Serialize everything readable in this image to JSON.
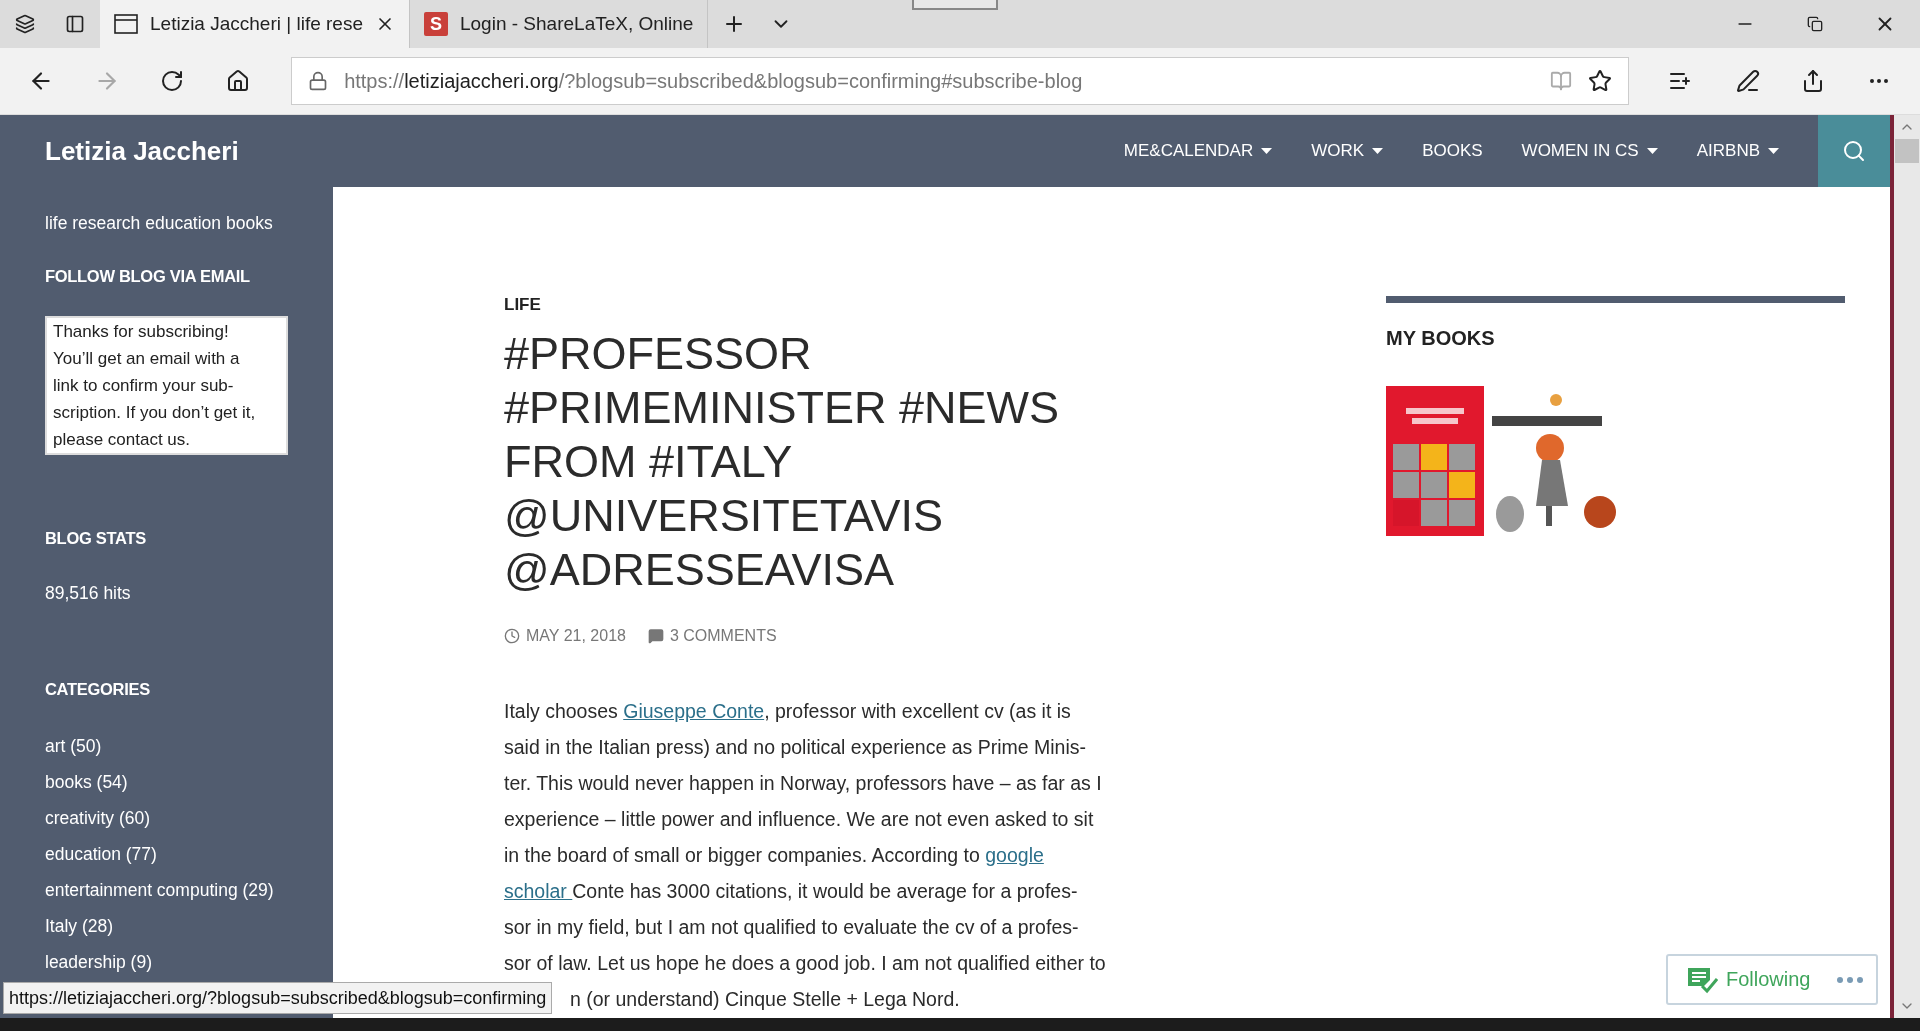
{
  "browser": {
    "tabs": [
      {
        "kind": "page",
        "title": "Letizia Jaccheri | life rese",
        "selected": true
      },
      {
        "kind": "logo",
        "badge": "S",
        "title": "Login - ShareLaTeX, Online",
        "selected": false
      }
    ],
    "nav_buttons": [
      {
        "kind": "back",
        "disabled": false
      },
      {
        "kind": "forward",
        "disabled": true
      },
      {
        "kind": "refresh",
        "disabled": false
      },
      {
        "kind": "home",
        "disabled": false
      }
    ],
    "address": {
      "scheme": "https://",
      "host": "letiziajaccheri.org",
      "rest": "/?blogsub=subscribed&blogsub=confirming#subscribe-blog"
    }
  },
  "site": {
    "title": "Letizia Jaccheri",
    "nav": [
      {
        "label": "ME&CALENDAR",
        "has_menu": true
      },
      {
        "label": "WORK",
        "has_menu": true
      },
      {
        "label": "BOOKS",
        "has_menu": false
      },
      {
        "label": "WOMEN IN CS",
        "has_menu": true
      },
      {
        "label": "AIRBNB",
        "has_menu": true
      }
    ]
  },
  "sidebar": {
    "tagline": "life research education books",
    "follow_heading": "FOLLOW BLOG VIA EMAIL",
    "follow_message_lines": [
      "Thanks for subscribing!",
      "You’ll get an email with a",
      "link to confirm your sub-",
      "scription. If you don’t get it,",
      "please contact us."
    ],
    "stats_heading": "BLOG STATS",
    "hits": "89,516 hits",
    "categories_heading": "CATEGORIES",
    "categories": [
      "art (50)",
      "books (54)",
      "creativity (60)",
      "education (77)",
      "entertainment computing (29)",
      "Italy (28)",
      "leadership (9)"
    ]
  },
  "post": {
    "category": "LIFE",
    "title": "#PROFESSOR #PRIMEMINISTER #NEWS FROM #ITALY @UNIVERSITETAVIS @ADRESSEAVISA",
    "date": "MAY 21, 2018",
    "comments": "3 COMMENTS",
    "lines": [
      [
        {
          "text": "Italy chooses ",
          "link": false
        },
        {
          "text": "Giuseppe Conte",
          "link": true
        },
        {
          "text": ", professor with excellent cv (as it is",
          "link": false
        }
      ],
      [
        {
          "text": "said in the Italian press) and no political experience as Prime Minis-",
          "link": false
        }
      ],
      [
        {
          "text": "ter. This would never happen in Norway, professors have – as far as I",
          "link": false
        }
      ],
      [
        {
          "text": "experience – little power and influence. We are not even asked to sit",
          "link": false
        }
      ],
      [
        {
          "text": "in the board of small or bigger companies.  According to ",
          "link": false
        },
        {
          "text": "google",
          "link": true
        }
      ],
      [
        {
          "text": "scholar ",
          "link": true
        },
        {
          "text": "Conte has 3000 citations, it would be average for a profes-",
          "link": false
        }
      ],
      [
        {
          "text": "sor in my field, but I am not qualified to evaluate the cv of a profes-",
          "link": false
        }
      ],
      [
        {
          "text": "sor of law. Let us hope he does a good job. I am not qualified either to",
          "link": false
        }
      ]
    ],
    "covered_line_rest": "n (or understand) Cinque Stelle + Lega Nord."
  },
  "widget": {
    "heading": "MY BOOKS"
  },
  "follow_button": {
    "label": "Following"
  },
  "status_url": "https://letiziajaccheri.org/?blogsub=subscribed&blogsub=confirming"
}
